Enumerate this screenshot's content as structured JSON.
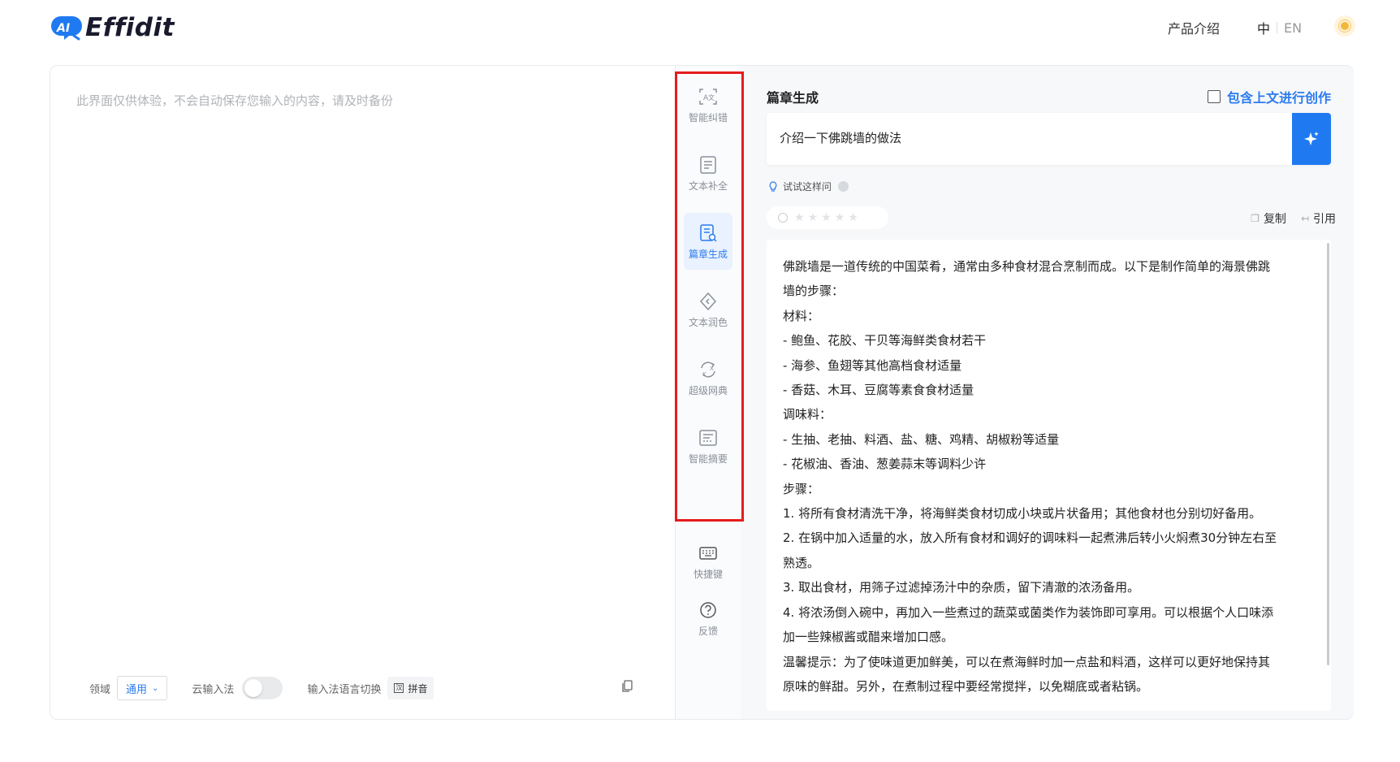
{
  "header": {
    "logo_text": "Effidit",
    "logo_badge": "AI",
    "nav_intro": "产品介绍",
    "lang_zh": "中",
    "lang_en": "EN",
    "theme_icon": "sun-icon"
  },
  "editor": {
    "placeholder": "此界面仅供体验，不会自动保存您输入的内容，请及时备份",
    "domain_label": "领域",
    "domain_value": "通用",
    "cloud_input_label": "云输入法",
    "lang_switch_label": "输入法语言切换",
    "pinyin_label": "拼音"
  },
  "tools": [
    {
      "label": "智能纠错",
      "icon": "error-correction-icon",
      "active": false
    },
    {
      "label": "文本补全",
      "icon": "text-completion-icon",
      "active": false
    },
    {
      "label": "篇章生成",
      "icon": "article-generation-icon",
      "active": true
    },
    {
      "label": "文本润色",
      "icon": "text-polish-icon",
      "active": false
    },
    {
      "label": "超级网典",
      "icon": "super-dictionary-icon",
      "active": false
    },
    {
      "label": "智能摘要",
      "icon": "smart-summary-icon",
      "active": false
    },
    {
      "label": "快捷键",
      "icon": "keyboard-icon",
      "active": false
    },
    {
      "label": "反馈",
      "icon": "help-icon",
      "active": false
    }
  ],
  "panel": {
    "title": "篇章生成",
    "include_context_label": "包含上文进行创作",
    "prompt_value": "介绍一下佛跳墙的做法",
    "try_ask_label": "试试这样问",
    "copy_label": "复制",
    "cite_label": "引用",
    "result_lines": [
      "佛跳墙是一道传统的中国菜肴，通常由多种食材混合烹制而成。以下是制作简单的海景佛跳",
      "墙的步骤：",
      "材料：",
      "- 鲍鱼、花胶、干贝等海鲜类食材若干",
      "- 海参、鱼翅等其他高档食材适量",
      "- 香菇、木耳、豆腐等素食食材适量",
      "调味料：",
      "- 生抽、老抽、料酒、盐、糖、鸡精、胡椒粉等适量",
      "- 花椒油、香油、葱姜蒜末等调料少许",
      "步骤：",
      "1. 将所有食材清洗干净，将海鲜类食材切成小块或片状备用；其他食材也分别切好备用。",
      "2. 在锅中加入适量的水，放入所有食材和调好的调味料一起煮沸后转小火焖煮30分钟左右至",
      "熟透。",
      "3. 取出食材，用筛子过滤掉汤汁中的杂质，留下清澈的浓汤备用。",
      "4. 将浓汤倒入碗中，再加入一些煮过的蔬菜或菌类作为装饰即可享用。可以根据个人口味添",
      "加一些辣椒酱或醋来增加口感。",
      "温馨提示：为了使味道更加鲜美，可以在煮海鲜时加一点盐和料酒，这样可以更好地保持其",
      "原味的鲜甜。另外，在煮制过程中要经常搅拌，以免糊底或者粘锅。"
    ]
  },
  "colors": {
    "accent": "#1f7af2",
    "highlight": "#e51c1c"
  }
}
